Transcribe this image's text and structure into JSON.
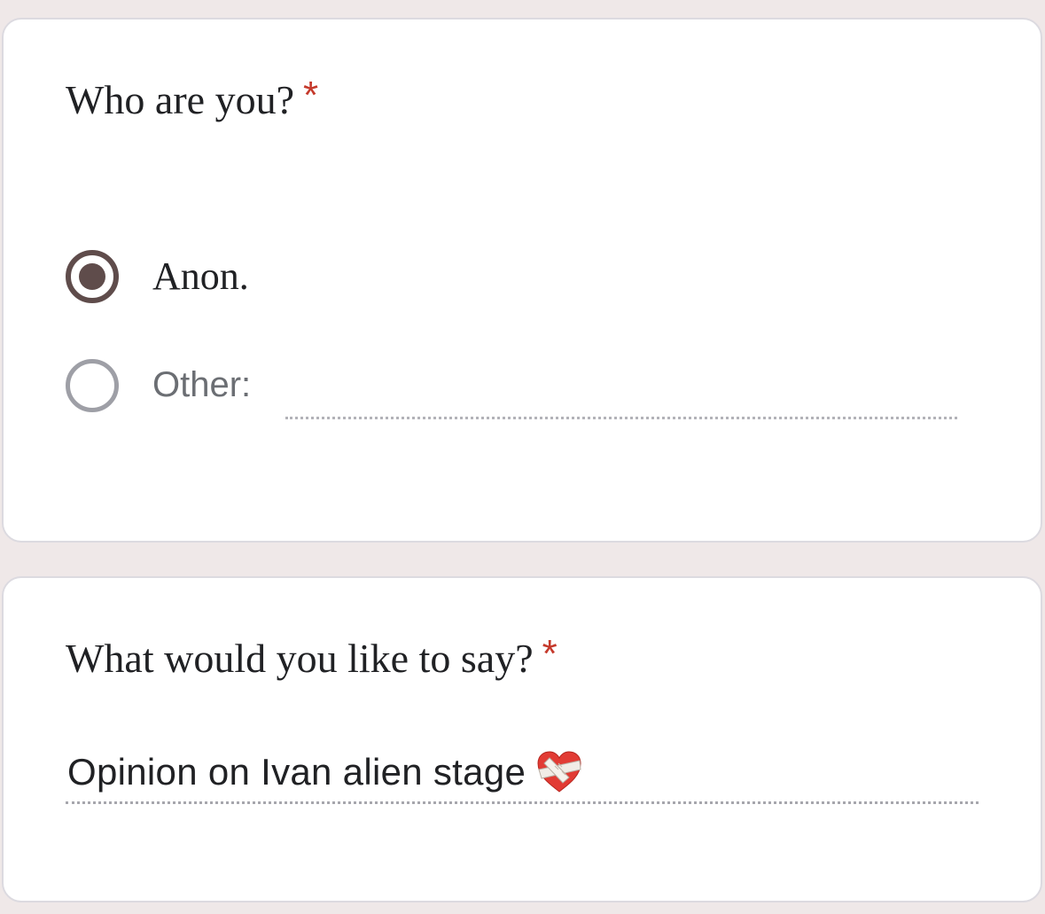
{
  "colors": {
    "background": "#efe8e8",
    "card": "#ffffff",
    "required": "#c5392b",
    "radio_selected": "#5f4c4b",
    "radio_unselected": "#9e9fa6"
  },
  "question_1": {
    "title": "Who are you?",
    "required_mark": "*",
    "options": [
      {
        "label": "Anon.",
        "selected": true
      },
      {
        "label": "Other:",
        "selected": false
      }
    ],
    "other_value": ""
  },
  "question_2": {
    "title": "What would you like to say?",
    "required_mark": "*",
    "answer_value": "Opinion on Ivan alien stage",
    "answer_icon": "mending-heart-icon"
  }
}
